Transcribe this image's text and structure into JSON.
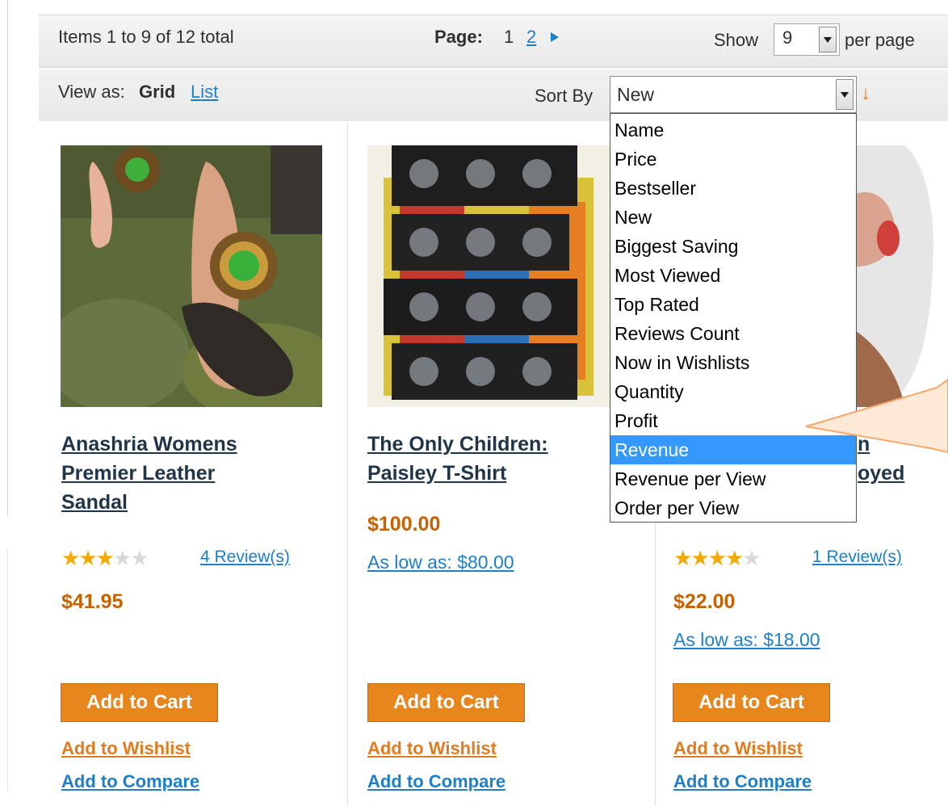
{
  "pager": {
    "items_total": "Items 1 to 9 of 12 total",
    "page_label": "Page:",
    "current_page": "1",
    "next_page": "2",
    "show_label": "Show",
    "per_page_value": "9",
    "per_page_label": "per page"
  },
  "sorter": {
    "view_as_label": "View as:",
    "view_grid": "Grid",
    "view_list": "List",
    "sort_by_label": "Sort By",
    "selected_sort": "New",
    "direction_arrow": "↓",
    "options": [
      "Name",
      "Price",
      "Bestseller",
      "New",
      "Biggest Saving",
      "Most Viewed",
      "Top Rated",
      "Reviews Count",
      "Now in Wishlists",
      "Quantity",
      "Profit",
      "Revenue",
      "Revenue per View",
      "Order per View"
    ],
    "highlighted_option": "Revenue"
  },
  "products": [
    {
      "name_lines": [
        "Anashria Womens",
        "Premier Leather",
        "Sandal"
      ],
      "rating_stars": 3,
      "reviews": "4 Review(s)",
      "price": "$41.95",
      "add_to_cart": "Add to Cart",
      "add_to_wishlist": "Add to Wishlist",
      "add_to_compare": "Add to Compare"
    },
    {
      "name_lines": [
        "The Only Children:",
        "Paisley T-Shirt"
      ],
      "price": "$100.00",
      "as_low_as": "As low as: $80.00",
      "add_to_cart": "Add to Cart",
      "add_to_wishlist": "Add to Wishlist",
      "add_to_compare": "Add to Compare"
    },
    {
      "name_lines_visible": [
        "n",
        "oyed"
      ],
      "rating_stars": 4,
      "reviews": "1 Review(s)",
      "price": "$22.00",
      "as_low_as": "As low as: $18.00",
      "add_to_cart": "Add to Cart",
      "add_to_wishlist": "Add to Wishlist",
      "add_to_compare": "Add to Compare"
    }
  ],
  "colors": {
    "link_blue": "#1e7ec8",
    "price_orange": "#c76200",
    "button_orange": "#e8861e",
    "highlight_blue": "#3399ff",
    "callout_orange": "#f5a86a"
  }
}
